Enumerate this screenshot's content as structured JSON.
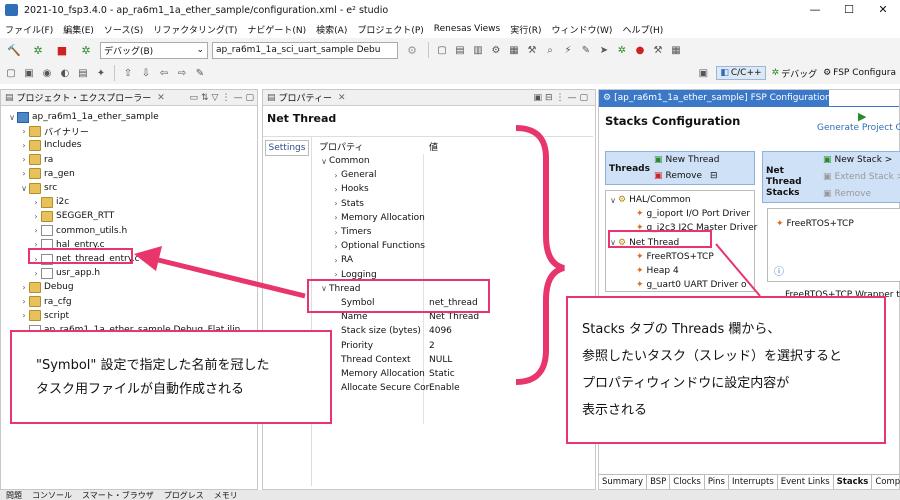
{
  "window": {
    "title": "2021-10_fsp3.4.0 - ap_ra6m1_1a_ether_sample/configuration.xml - e² studio",
    "controls": [
      "—",
      "☐",
      "✕"
    ]
  },
  "menu": [
    "ファイル(F)",
    "編集(E)",
    "ソース(S)",
    "リファクタリング(T)",
    "ナビゲート(N)",
    "検索(A)",
    "プロジェクト(P)",
    "Renesas Views",
    "実行(R)",
    "ウィンドウ(W)",
    "ヘルプ(H)"
  ],
  "toolbar": {
    "debug_combo": "デバッグ(B)",
    "launch_combo": "ap_ra6m1_1a_sci_uart_sample Debu",
    "perspectives": {
      "cpp": "C/C++",
      "debug": "デバッグ",
      "fsp": "FSP Configura"
    }
  },
  "explorer": {
    "title": "プロジェクト・エクスプローラー",
    "tree": [
      {
        "label": "ap_ra6m1_1a_ether_sample",
        "level": 0,
        "chev": "∨",
        "icon": "proj"
      },
      {
        "label": "バイナリー",
        "level": 1,
        "chev": "›",
        "icon": "folder"
      },
      {
        "label": "Includes",
        "level": 1,
        "chev": "›",
        "icon": "folder"
      },
      {
        "label": "ra",
        "level": 1,
        "chev": "›",
        "icon": "folder"
      },
      {
        "label": "ra_gen",
        "level": 1,
        "chev": "›",
        "icon": "folder"
      },
      {
        "label": "src",
        "level": 1,
        "chev": "∨",
        "icon": "folder"
      },
      {
        "label": "i2c",
        "level": 2,
        "chev": "›",
        "icon": "folder"
      },
      {
        "label": "SEGGER_RTT",
        "level": 2,
        "chev": "›",
        "icon": "folder"
      },
      {
        "label": "common_utils.h",
        "level": 2,
        "chev": "›",
        "icon": "file"
      },
      {
        "label": "hal_entry.c",
        "level": 2,
        "chev": "›",
        "icon": "file"
      },
      {
        "label": "net_thread_entry.c",
        "level": 2,
        "chev": "›",
        "icon": "file"
      },
      {
        "label": "usr_app.h",
        "level": 2,
        "chev": "›",
        "icon": "file"
      },
      {
        "label": "Debug",
        "level": 1,
        "chev": "›",
        "icon": "folder"
      },
      {
        "label": "ra_cfg",
        "level": 1,
        "chev": "›",
        "icon": "folder"
      },
      {
        "label": "script",
        "level": 1,
        "chev": "›",
        "icon": "folder"
      },
      {
        "label": "ap_ra6m1_1a_ether_sample Debug_Flat.jlin",
        "level": 1,
        "chev": "",
        "icon": "file"
      }
    ]
  },
  "properties": {
    "title": "プロパティー",
    "heading": "Net Thread",
    "side_tab": "Settings",
    "col_property": "プロパティ",
    "col_value": "値",
    "rows": [
      {
        "name": "Common",
        "value": "",
        "level": 0,
        "chev": "∨"
      },
      {
        "name": "General",
        "value": "",
        "level": 1,
        "chev": "›"
      },
      {
        "name": "Hooks",
        "value": "",
        "level": 1,
        "chev": "›"
      },
      {
        "name": "Stats",
        "value": "",
        "level": 1,
        "chev": "›"
      },
      {
        "name": "Memory Allocation",
        "value": "",
        "level": 1,
        "chev": "›"
      },
      {
        "name": "Timers",
        "value": "",
        "level": 1,
        "chev": "›"
      },
      {
        "name": "Optional Functions",
        "value": "",
        "level": 1,
        "chev": "›"
      },
      {
        "name": "RA",
        "value": "",
        "level": 1,
        "chev": "›"
      },
      {
        "name": "Logging",
        "value": "",
        "level": 1,
        "chev": "›"
      },
      {
        "name": "Thread",
        "value": "",
        "level": 0,
        "chev": "∨"
      },
      {
        "name": "Symbol",
        "value": "net_thread",
        "level": 1,
        "chev": ""
      },
      {
        "name": "Name",
        "value": "Net Thread",
        "level": 1,
        "chev": ""
      },
      {
        "name": "Stack size (bytes)",
        "value": "4096",
        "level": 1,
        "chev": ""
      },
      {
        "name": "Priority",
        "value": "2",
        "level": 1,
        "chev": ""
      },
      {
        "name": "Thread Context",
        "value": "NULL",
        "level": 1,
        "chev": ""
      },
      {
        "name": "Memory Allocation",
        "value": "Static",
        "level": 1,
        "chev": ""
      },
      {
        "name": "Allocate Secure Cor",
        "value": "Enable",
        "level": 1,
        "chev": ""
      }
    ]
  },
  "fsp": {
    "tab_title": "[ap_ra6m1_1a_ether_sample] FSP Configuration",
    "heading": "Stacks Configuration",
    "generate": "Generate Project Co",
    "threads_label": "Threads",
    "new_thread": "New Thread",
    "remove": "Remove",
    "net_thread_stacks": "Net Thread Stacks",
    "new_stack": "New Stack >",
    "extend_stack": "Extend Stack >",
    "remove2": "Remove",
    "threads": [
      {
        "label": "HAL/Common",
        "level": 0,
        "chev": "∨"
      },
      {
        "label": "g_ioport I/O Port Driver",
        "level": 1,
        "chev": ""
      },
      {
        "label": "g_i2c3 I2C Master Driver",
        "level": 1,
        "chev": ""
      },
      {
        "label": "Net Thread",
        "level": 0,
        "chev": "∨"
      },
      {
        "label": "FreeRTOS+TCP",
        "level": 1,
        "chev": ""
      },
      {
        "label": "Heap 4",
        "level": 1,
        "chev": ""
      },
      {
        "label": "g_uart0 UART Driver o",
        "level": 1,
        "chev": ""
      }
    ],
    "stack_block": "FreeRTOS+TCP",
    "stack_block2": "FreeRTOS+TCP Wrapper to",
    "info_icon": "ⓘ",
    "bottom_tabs": [
      "Summary",
      "BSP",
      "Clocks",
      "Pins",
      "Interrupts",
      "Event Links",
      "Stacks",
      "Componen"
    ]
  },
  "callouts": {
    "left": "\"Symbol\" 設定で指定した名前を冠した\nタスク用ファイルが自動作成される",
    "right_lines": [
      "Stacks タブの Threads 欄から、",
      "参照したいタスク（スレッド）を選択すると",
      "プロパティウィンドウに設定内容が",
      "表示される"
    ]
  },
  "statusbar": [
    "問題",
    "コンソール",
    "スマート・ブラウザ",
    "プログレス",
    "メモリ"
  ],
  "colors": {
    "accent": "#e8356b",
    "tab_active": "#3c78c8",
    "highlight_bg": "#cfe1f7"
  }
}
